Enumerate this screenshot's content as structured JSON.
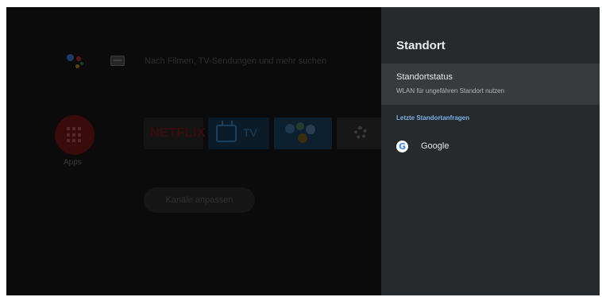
{
  "home": {
    "search_hint": "Nach Filmen, TV-Sendungen und mehr suchen",
    "apps_label": "Apps",
    "tiles": {
      "netflix": "NETFLIX",
      "tv": "TV"
    },
    "customize_button": "Kanäle anpassen"
  },
  "panel": {
    "title": "Standort",
    "status_item": {
      "title": "Standortstatus",
      "subtitle": "WLAN für ungefähren Standort nutzen"
    },
    "section_header": "Letzte Standortanfragen",
    "recent_apps": [
      {
        "name": "Google",
        "icon": "google-icon"
      }
    ]
  },
  "colors": {
    "panel_bg": "#262a2c",
    "selected_item_bg": "#373b3d",
    "section_accent": "#7cb0e8"
  }
}
